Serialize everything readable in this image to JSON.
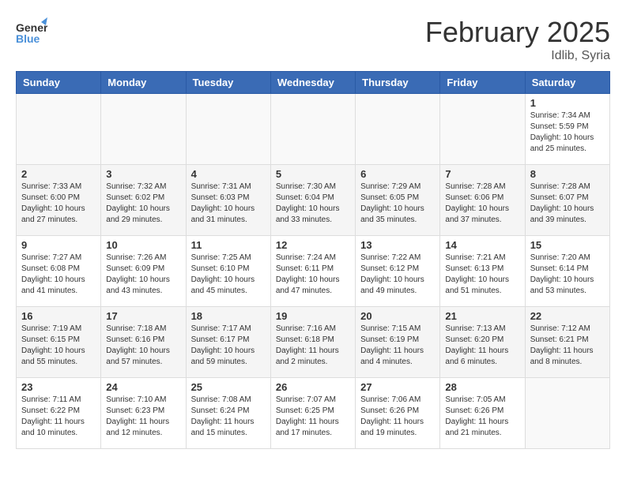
{
  "header": {
    "logo": {
      "general": "General",
      "blue": "Blue"
    },
    "title": "February 2025",
    "location": "Idlib, Syria"
  },
  "weekdays": [
    "Sunday",
    "Monday",
    "Tuesday",
    "Wednesday",
    "Thursday",
    "Friday",
    "Saturday"
  ],
  "weeks": [
    {
      "shaded": false,
      "days": [
        {
          "num": "",
          "info": ""
        },
        {
          "num": "",
          "info": ""
        },
        {
          "num": "",
          "info": ""
        },
        {
          "num": "",
          "info": ""
        },
        {
          "num": "",
          "info": ""
        },
        {
          "num": "",
          "info": ""
        },
        {
          "num": "1",
          "info": "Sunrise: 7:34 AM\nSunset: 5:59 PM\nDaylight: 10 hours\nand 25 minutes."
        }
      ]
    },
    {
      "shaded": true,
      "days": [
        {
          "num": "2",
          "info": "Sunrise: 7:33 AM\nSunset: 6:00 PM\nDaylight: 10 hours\nand 27 minutes."
        },
        {
          "num": "3",
          "info": "Sunrise: 7:32 AM\nSunset: 6:02 PM\nDaylight: 10 hours\nand 29 minutes."
        },
        {
          "num": "4",
          "info": "Sunrise: 7:31 AM\nSunset: 6:03 PM\nDaylight: 10 hours\nand 31 minutes."
        },
        {
          "num": "5",
          "info": "Sunrise: 7:30 AM\nSunset: 6:04 PM\nDaylight: 10 hours\nand 33 minutes."
        },
        {
          "num": "6",
          "info": "Sunrise: 7:29 AM\nSunset: 6:05 PM\nDaylight: 10 hours\nand 35 minutes."
        },
        {
          "num": "7",
          "info": "Sunrise: 7:28 AM\nSunset: 6:06 PM\nDaylight: 10 hours\nand 37 minutes."
        },
        {
          "num": "8",
          "info": "Sunrise: 7:28 AM\nSunset: 6:07 PM\nDaylight: 10 hours\nand 39 minutes."
        }
      ]
    },
    {
      "shaded": false,
      "days": [
        {
          "num": "9",
          "info": "Sunrise: 7:27 AM\nSunset: 6:08 PM\nDaylight: 10 hours\nand 41 minutes."
        },
        {
          "num": "10",
          "info": "Sunrise: 7:26 AM\nSunset: 6:09 PM\nDaylight: 10 hours\nand 43 minutes."
        },
        {
          "num": "11",
          "info": "Sunrise: 7:25 AM\nSunset: 6:10 PM\nDaylight: 10 hours\nand 45 minutes."
        },
        {
          "num": "12",
          "info": "Sunrise: 7:24 AM\nSunset: 6:11 PM\nDaylight: 10 hours\nand 47 minutes."
        },
        {
          "num": "13",
          "info": "Sunrise: 7:22 AM\nSunset: 6:12 PM\nDaylight: 10 hours\nand 49 minutes."
        },
        {
          "num": "14",
          "info": "Sunrise: 7:21 AM\nSunset: 6:13 PM\nDaylight: 10 hours\nand 51 minutes."
        },
        {
          "num": "15",
          "info": "Sunrise: 7:20 AM\nSunset: 6:14 PM\nDaylight: 10 hours\nand 53 minutes."
        }
      ]
    },
    {
      "shaded": true,
      "days": [
        {
          "num": "16",
          "info": "Sunrise: 7:19 AM\nSunset: 6:15 PM\nDaylight: 10 hours\nand 55 minutes."
        },
        {
          "num": "17",
          "info": "Sunrise: 7:18 AM\nSunset: 6:16 PM\nDaylight: 10 hours\nand 57 minutes."
        },
        {
          "num": "18",
          "info": "Sunrise: 7:17 AM\nSunset: 6:17 PM\nDaylight: 10 hours\nand 59 minutes."
        },
        {
          "num": "19",
          "info": "Sunrise: 7:16 AM\nSunset: 6:18 PM\nDaylight: 11 hours\nand 2 minutes."
        },
        {
          "num": "20",
          "info": "Sunrise: 7:15 AM\nSunset: 6:19 PM\nDaylight: 11 hours\nand 4 minutes."
        },
        {
          "num": "21",
          "info": "Sunrise: 7:13 AM\nSunset: 6:20 PM\nDaylight: 11 hours\nand 6 minutes."
        },
        {
          "num": "22",
          "info": "Sunrise: 7:12 AM\nSunset: 6:21 PM\nDaylight: 11 hours\nand 8 minutes."
        }
      ]
    },
    {
      "shaded": false,
      "days": [
        {
          "num": "23",
          "info": "Sunrise: 7:11 AM\nSunset: 6:22 PM\nDaylight: 11 hours\nand 10 minutes."
        },
        {
          "num": "24",
          "info": "Sunrise: 7:10 AM\nSunset: 6:23 PM\nDaylight: 11 hours\nand 12 minutes."
        },
        {
          "num": "25",
          "info": "Sunrise: 7:08 AM\nSunset: 6:24 PM\nDaylight: 11 hours\nand 15 minutes."
        },
        {
          "num": "26",
          "info": "Sunrise: 7:07 AM\nSunset: 6:25 PM\nDaylight: 11 hours\nand 17 minutes."
        },
        {
          "num": "27",
          "info": "Sunrise: 7:06 AM\nSunset: 6:26 PM\nDaylight: 11 hours\nand 19 minutes."
        },
        {
          "num": "28",
          "info": "Sunrise: 7:05 AM\nSunset: 6:26 PM\nDaylight: 11 hours\nand 21 minutes."
        },
        {
          "num": "",
          "info": ""
        }
      ]
    }
  ]
}
